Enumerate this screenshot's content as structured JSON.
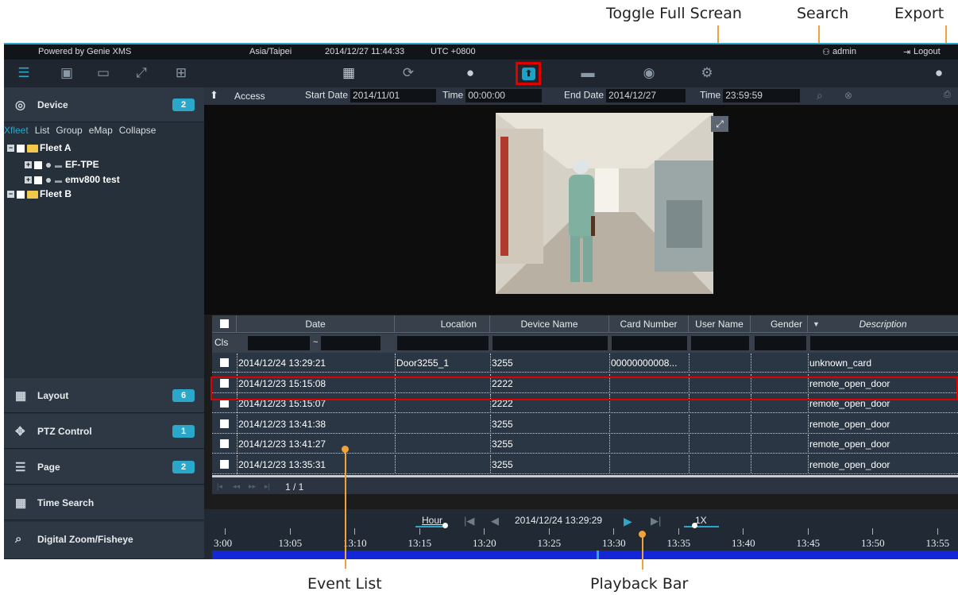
{
  "callouts": {
    "toggle_full_screen": "Toggle Full Screan",
    "search": "Search",
    "export": "Export",
    "event_list": "Event List",
    "playback_bar": "Playback Bar"
  },
  "topbar": {
    "powered_by": "Powered by Genie XMS",
    "timezone": "Asia/Taipei",
    "datetime": "2014/12/27 11:44:33",
    "utc": "UTC +0800",
    "user": "admin",
    "logout": "Logout"
  },
  "sidebar": {
    "device": {
      "label": "Device",
      "badge": "2"
    },
    "tree_nav": [
      "Xfleet",
      "List",
      "Group",
      "eMap",
      "Collapse"
    ],
    "tree": [
      {
        "label": "Fleet A"
      },
      {
        "label": "EF-TPE"
      },
      {
        "label": "emv800 test"
      },
      {
        "label": "Fleet B"
      }
    ],
    "layout": {
      "label": "Layout",
      "badge": "6"
    },
    "ptz": {
      "label": "PTZ Control",
      "badge": "1"
    },
    "page": {
      "label": "Page",
      "badge": "2"
    },
    "time_search": {
      "label": "Time Search"
    },
    "digital_zoom": {
      "label": "Digital Zoom/Fisheye"
    }
  },
  "filter": {
    "category": "Access",
    "start_date_label": "Start Date",
    "start_date": "2014/11/01",
    "time_label": "Time",
    "start_time": "00:00:00",
    "end_date_label": "End Date",
    "end_date": "2014/12/27",
    "end_time": "23:59:59"
  },
  "table": {
    "columns": [
      "Date",
      "Location",
      "Device Name",
      "Card Number",
      "User Name",
      "Gender",
      "Description"
    ],
    "cls_label": "Cls",
    "range_sep": "~",
    "rows": [
      {
        "date": "2014/12/24 13:29:21",
        "location": "Door3255_1",
        "device": "3255",
        "card": "00000000008...",
        "user": "",
        "gender": "",
        "desc": "unknown_card"
      },
      {
        "date": "2014/12/23 15:15:08",
        "location": "",
        "device": "2222",
        "card": "",
        "user": "",
        "gender": "",
        "desc": "remote_open_door"
      },
      {
        "date": "2014/12/23 15:15:07",
        "location": "",
        "device": "2222",
        "card": "",
        "user": "",
        "gender": "",
        "desc": "remote_open_door"
      },
      {
        "date": "2014/12/23 13:41:38",
        "location": "",
        "device": "3255",
        "card": "",
        "user": "",
        "gender": "",
        "desc": "remote_open_door"
      },
      {
        "date": "2014/12/23 13:41:27",
        "location": "",
        "device": "3255",
        "card": "",
        "user": "",
        "gender": "",
        "desc": "remote_open_door"
      },
      {
        "date": "2014/12/23 13:35:31",
        "location": "",
        "device": "3255",
        "card": "",
        "user": "",
        "gender": "",
        "desc": "remote_open_door"
      }
    ],
    "page": "1 / 1"
  },
  "playback": {
    "unit": "Hour",
    "current": "2014/12/24 13:29:29",
    "speed": "1X",
    "ticks": [
      "3:00",
      "13:05",
      "13:10",
      "13:15",
      "13:20",
      "13:25",
      "13:30",
      "13:35",
      "13:40",
      "13:45",
      "13:50",
      "13:55"
    ]
  }
}
